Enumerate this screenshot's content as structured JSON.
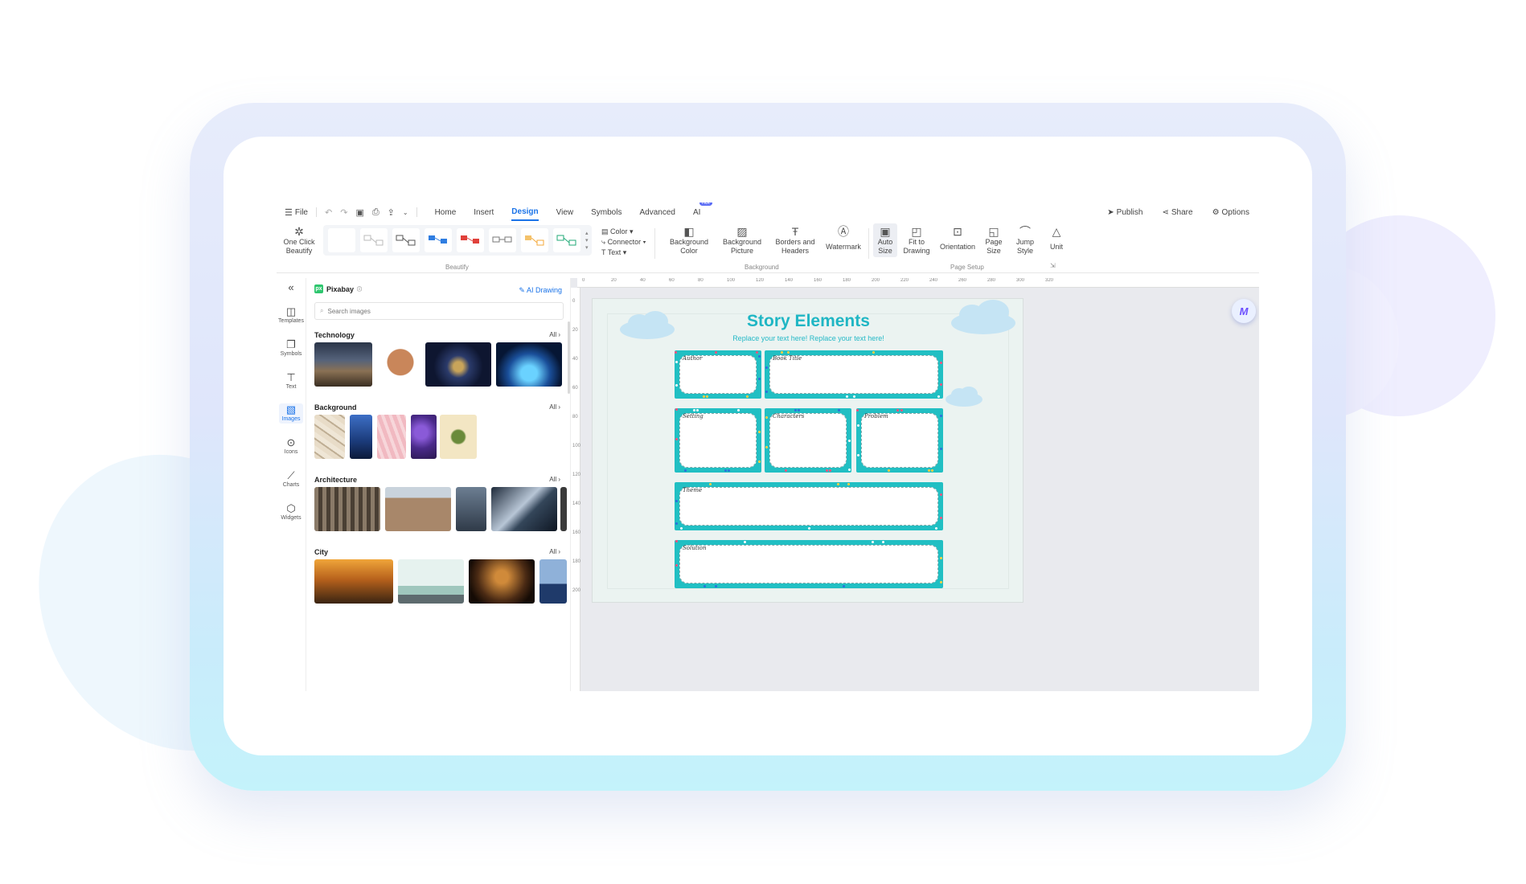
{
  "menubar": {
    "file_label": "File",
    "tabs": [
      {
        "label": "Home",
        "active": false
      },
      {
        "label": "Insert",
        "active": false
      },
      {
        "label": "Design",
        "active": true
      },
      {
        "label": "View",
        "active": false
      },
      {
        "label": "Symbols",
        "active": false
      },
      {
        "label": "Advanced",
        "active": false
      },
      {
        "label": "AI",
        "active": false
      }
    ],
    "hot_badge": "hot",
    "publish": "Publish",
    "share": "Share",
    "options": "Options"
  },
  "ribbon": {
    "one_click_1": "One Click",
    "one_click_2": "Beautify",
    "color": "Color",
    "connector": "Connector",
    "text": "Text",
    "bg_color_1": "Background",
    "bg_color_2": "Color",
    "bg_picture_1": "Background",
    "bg_picture_2": "Picture",
    "borders_1": "Borders and",
    "borders_2": "Headers",
    "watermark": "Watermark",
    "auto_size_1": "Auto",
    "auto_size_2": "Size",
    "fit_1": "Fit to",
    "fit_2": "Drawing",
    "orientation": "Orientation",
    "page_size_1": "Page",
    "page_size_2": "Size",
    "jump_1": "Jump",
    "jump_2": "Style",
    "unit": "Unit",
    "group_beautify": "Beautify",
    "group_background": "Background",
    "group_page_setup": "Page Setup"
  },
  "rail": [
    {
      "label": "Templates",
      "icon": "templates-icon",
      "active": false
    },
    {
      "label": "Symbols",
      "icon": "symbols-icon",
      "active": false
    },
    {
      "label": "Text",
      "icon": "text-icon",
      "active": false
    },
    {
      "label": "Images",
      "icon": "images-icon",
      "active": true
    },
    {
      "label": "Icons",
      "icon": "icons-icon",
      "active": false
    },
    {
      "label": "Charts",
      "icon": "charts-icon",
      "active": false
    },
    {
      "label": "Widgets",
      "icon": "widgets-icon",
      "active": false
    }
  ],
  "panel": {
    "source": "Pixabay",
    "ai_drawing": "AI Drawing",
    "search_placeholder": "Search images",
    "all_label": "All",
    "categories": [
      "Technology",
      "Background",
      "Architecture",
      "City"
    ]
  },
  "ruler": {
    "h_ticks": [
      "0",
      "20",
      "40",
      "60",
      "80",
      "100",
      "120",
      "140",
      "160",
      "180",
      "200",
      "220",
      "240",
      "260",
      "280",
      "300",
      "320"
    ],
    "v_ticks": [
      "0",
      "20",
      "40",
      "60",
      "80",
      "100",
      "120",
      "140",
      "160",
      "180",
      "200"
    ]
  },
  "page": {
    "title": "Story Elements",
    "subtitle": "Replace your text here!   Replace your text here!",
    "cards": [
      "Author",
      "Book Title",
      "Setting",
      "Characters",
      "Problem",
      "Theme",
      "Solution"
    ]
  },
  "colors": {
    "accent": "#1a73e8",
    "title": "#1fb6c4",
    "card": "#21bfc3"
  }
}
